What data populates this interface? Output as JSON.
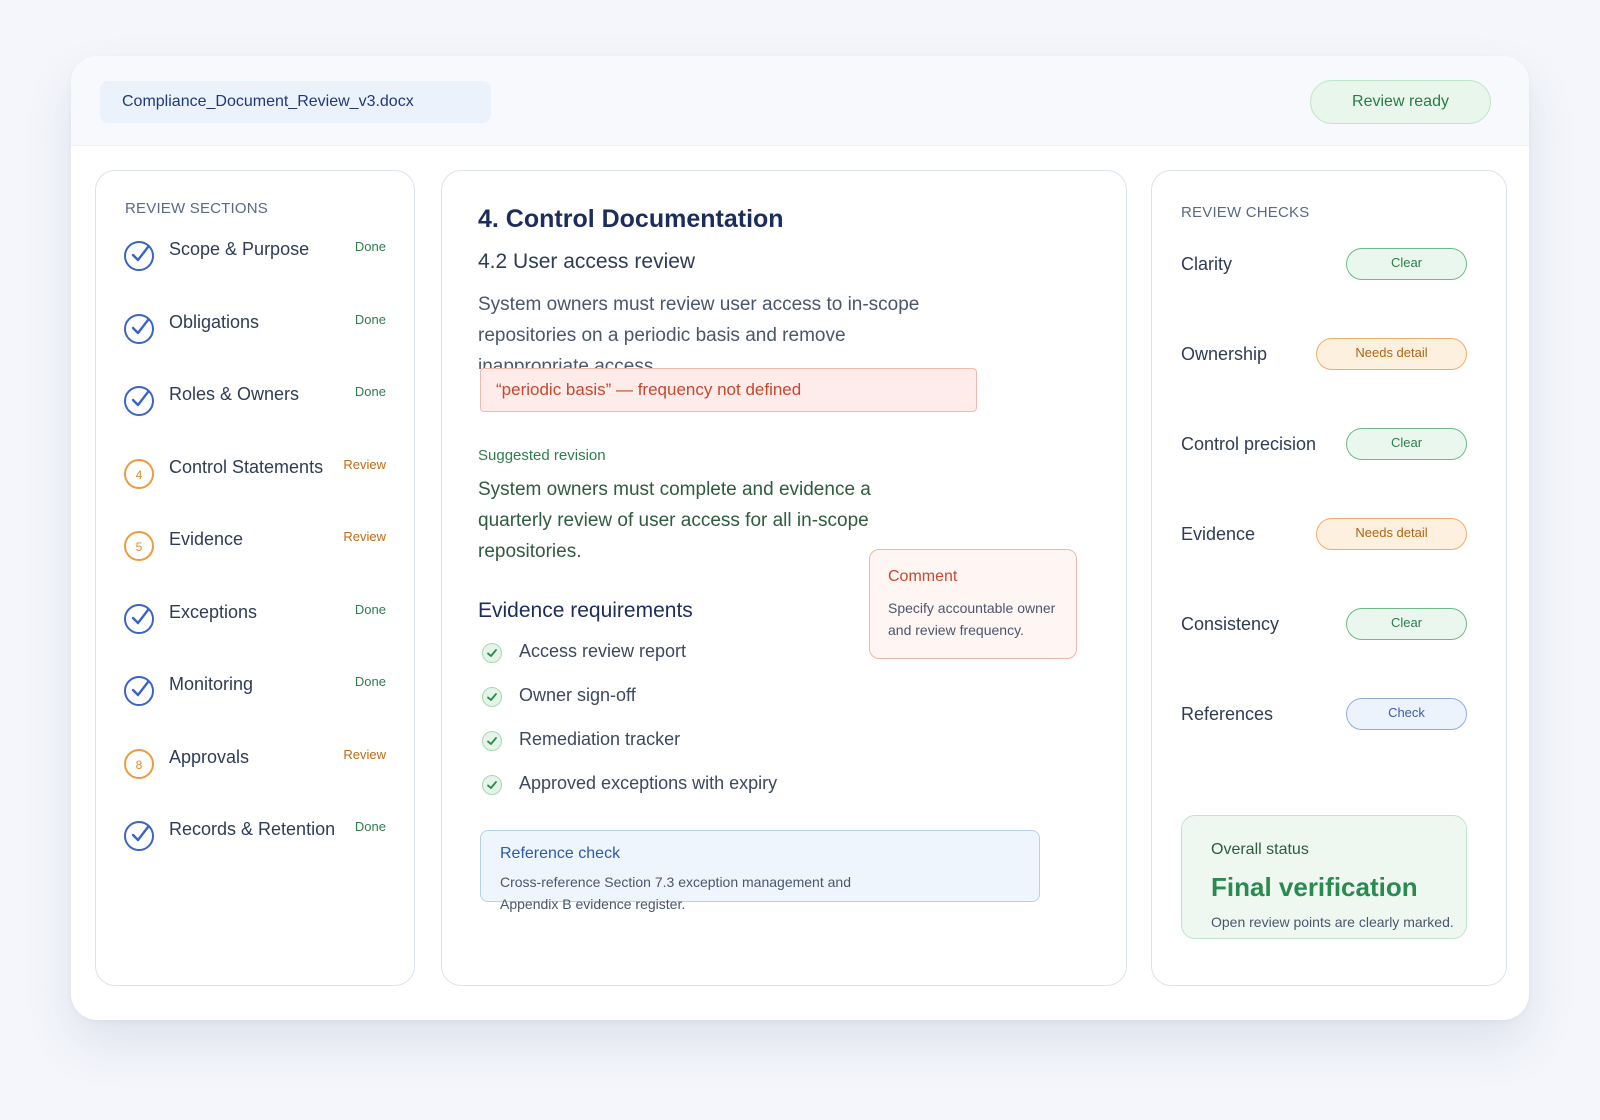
{
  "topbar": {
    "filename": "Compliance_Document_Review_v3.docx",
    "status_pill": "Review ready"
  },
  "sections": {
    "heading": "REVIEW SECTIONS",
    "items": [
      {
        "label": "Scope & Purpose",
        "status": "Done",
        "state": "done",
        "number": ""
      },
      {
        "label": "Obligations",
        "status": "Done",
        "state": "done",
        "number": ""
      },
      {
        "label": "Roles & Owners",
        "status": "Done",
        "state": "done",
        "number": ""
      },
      {
        "label": "Control Statements",
        "status": "Review",
        "state": "review",
        "number": "4"
      },
      {
        "label": "Evidence",
        "status": "Review",
        "state": "review",
        "number": "5"
      },
      {
        "label": "Exceptions",
        "status": "Done",
        "state": "done",
        "number": ""
      },
      {
        "label": "Monitoring",
        "status": "Done",
        "state": "done",
        "number": ""
      },
      {
        "label": "Approvals",
        "status": "Review",
        "state": "review",
        "number": "8"
      },
      {
        "label": "Records & Retention",
        "status": "Done",
        "state": "done",
        "number": ""
      }
    ]
  },
  "document": {
    "title": "4. Control Documentation",
    "subtitle": "4.2 User access review",
    "body": "System owners must review user access to in-scope repositories on a periodic basis and remove inappropriate access.",
    "flag": "“periodic basis” — frequency not defined",
    "suggestion_label": "Suggested revision",
    "suggestion_text": "System owners must complete and evidence a quarterly review of user access for all in-scope repositories.",
    "comment": {
      "title": "Comment",
      "text": "Specify accountable owner and review frequency."
    },
    "evidence_heading": "Evidence requirements",
    "evidence_items": [
      "Access review report",
      "Owner sign-off",
      "Remediation tracker",
      "Approved exceptions with expiry"
    ],
    "reference": {
      "title": "Reference check",
      "text": "Cross-reference Section 7.3 exception management and Appendix B evidence register."
    }
  },
  "checks": {
    "heading": "REVIEW CHECKS",
    "items": [
      {
        "label": "Clarity",
        "status": "Clear",
        "kind": "clear"
      },
      {
        "label": "Ownership",
        "status": "Needs detail",
        "kind": "needs"
      },
      {
        "label": "Control precision",
        "status": "Clear",
        "kind": "clear"
      },
      {
        "label": "Evidence",
        "status": "Needs detail",
        "kind": "needs"
      },
      {
        "label": "Consistency",
        "status": "Clear",
        "kind": "clear"
      },
      {
        "label": "References",
        "status": "Check",
        "kind": "check"
      }
    ],
    "overall": {
      "label": "Overall status",
      "title": "Final verification",
      "note": "Open review points are clearly marked."
    }
  },
  "colors": {
    "accent_blue": "#3a64c5",
    "review_orange": "#ee9a3f",
    "success_green": "#2a8a4f",
    "flag_red": "#c6482e"
  },
  "icons": {
    "done": "check-circle-icon",
    "review": "numbered-circle-icon",
    "evidence": "check-badge-icon"
  }
}
